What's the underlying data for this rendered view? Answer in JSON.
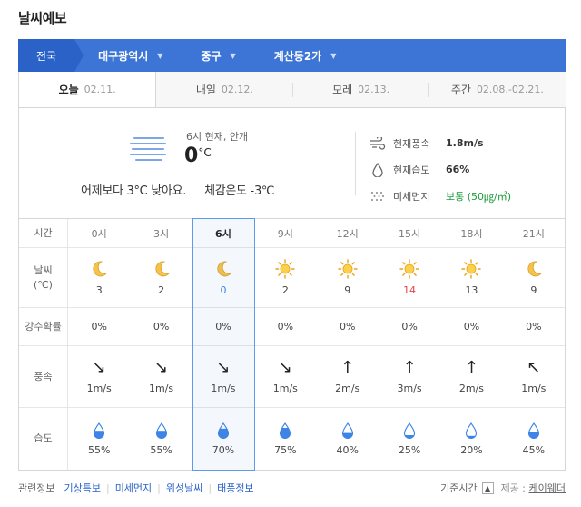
{
  "title": "날씨예보",
  "locations": [
    {
      "label": "전국",
      "has_caret": false
    },
    {
      "label": "대구광역시",
      "has_caret": true
    },
    {
      "label": "중구",
      "has_caret": true
    },
    {
      "label": "계산동2가",
      "has_caret": true
    }
  ],
  "tabs": [
    {
      "day": "오늘",
      "date": "02.11."
    },
    {
      "day": "내일",
      "date": "02.12."
    },
    {
      "day": "모레",
      "date": "02.13."
    },
    {
      "day": "주간",
      "date": "02.08.-02.21."
    }
  ],
  "current": {
    "time_condition": "6시 현재, 안개",
    "temp_value": "0",
    "temp_unit": "°C",
    "compare": "어제보다 3°C 낮아요.",
    "feels_like": "체감온도 -3℃",
    "wind_label": "현재풍속",
    "wind_value": "1.8m/s",
    "humidity_label": "현재습도",
    "humidity_value": "66%",
    "dust_label": "미세먼지",
    "dust_value": "보통 (50㎍/㎥)"
  },
  "table": {
    "time_label": "시간",
    "weather_label_line1": "날씨",
    "weather_label_line2": "(℃)",
    "precip_label": "강수확률",
    "wind_label": "풍속",
    "humidity_label": "습도",
    "hours": [
      "0시",
      "3시",
      "6시",
      "9시",
      "12시",
      "15시",
      "18시",
      "21시"
    ],
    "icons": [
      "moon",
      "moon",
      "moon",
      "sun",
      "sun",
      "sun",
      "sun",
      "moon"
    ],
    "temps": [
      "3",
      "2",
      "0",
      "2",
      "9",
      "14",
      "13",
      "9"
    ],
    "precip": [
      "0%",
      "0%",
      "0%",
      "0%",
      "0%",
      "0%",
      "0%",
      "0%"
    ],
    "wind_arrows": [
      "↘",
      "↘",
      "↘",
      "↘",
      "↑",
      "↑",
      "↑",
      "↖"
    ],
    "wind_speeds": [
      "1m/s",
      "1m/s",
      "1m/s",
      "1m/s",
      "2m/s",
      "3m/s",
      "2m/s",
      "1m/s"
    ],
    "humidity_levels": [
      0.55,
      0.55,
      0.7,
      0.75,
      0.4,
      0.25,
      0.2,
      0.45
    ],
    "humidity": [
      "55%",
      "55%",
      "70%",
      "75%",
      "40%",
      "25%",
      "20%",
      "45%"
    ],
    "selected_index": 2,
    "hot_index": 5
  },
  "footer": {
    "related": "관련정보",
    "links": [
      "기상특보",
      "미세먼지",
      "위성날씨",
      "태풍정보"
    ],
    "base_time": "기준시간",
    "provider_label": "제공 :",
    "provider": "케이웨더"
  },
  "colors": {
    "accent": "#3d75d6",
    "selected": "#3d84e6",
    "hot": "#e0454a",
    "good": "#1a9a3a"
  }
}
